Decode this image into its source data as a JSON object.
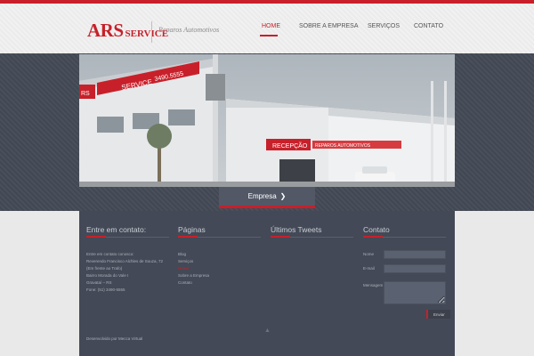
{
  "header": {
    "logo_ars": "ARS",
    "logo_service": "SERVICE",
    "tagline": "Reparos Automotivos",
    "nav": [
      {
        "label": "HOME",
        "active": true
      },
      {
        "label": "SOBRE A EMPRESA",
        "active": false
      },
      {
        "label": "SERVIÇOS",
        "active": false
      },
      {
        "label": "CONTATO",
        "active": false
      }
    ]
  },
  "hero": {
    "sign_phone": "3490.5555",
    "sign_service": "SERVICE",
    "sign_recepcao": "RECEPÇÃO",
    "sign_reparos": "REPAROS AUTOMOTIVOS",
    "sign_ars_partial": "RS",
    "tab_label": "Empresa",
    "tab_arrow": "❯"
  },
  "footer": {
    "contact_title": "Entre em contato:",
    "contact_lines": [
      "Entre em contato conosco:",
      "Reverendo Francisco Alchles de Souza, 72",
      "(Em frente ao Trafo)",
      "Bairro Morada do Vale I",
      "Gravataí – RS",
      "Fone: (51) 3490-5555"
    ],
    "pages_title": "Páginas",
    "pages_links": [
      "Blog",
      "Serviços",
      "Home",
      "Sobre a Empresa",
      "Contato"
    ],
    "tweets_title": "Últimos Tweets",
    "form_title": "Contato",
    "form_labels": {
      "name": "Nome",
      "email": "E-mail",
      "message": "Mensagem"
    },
    "send_label": "Enviar",
    "credit": "Desenvolvido por Mecca Virtual",
    "up_arrow": "▲"
  },
  "colors": {
    "accent": "#c8202a",
    "footer_bg": "#434956",
    "banner_bg": "#444a56"
  }
}
